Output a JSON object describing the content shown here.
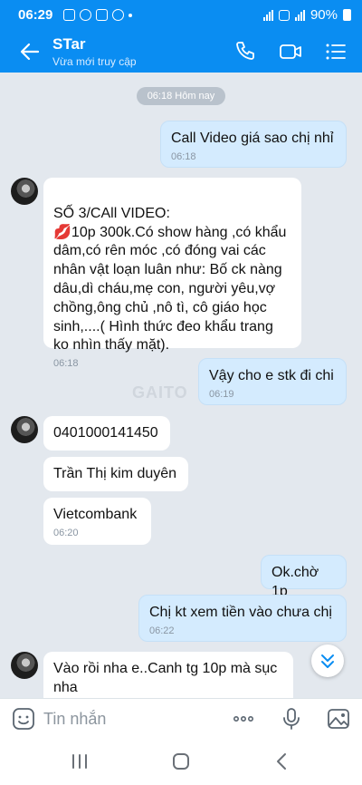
{
  "status_bar": {
    "time": "06:29",
    "battery": "90%"
  },
  "header": {
    "title": "STar",
    "subtitle": "Vừa mới truy cập"
  },
  "chat": {
    "day_label": "06:18 Hôm nay",
    "watermark": "GAITO",
    "messages": [
      {
        "id": "m1",
        "dir": "out",
        "text": "Call Video giá sao chị nhỉ",
        "time": "06:18"
      },
      {
        "id": "m2",
        "dir": "in",
        "text": "SỐ 3/CAll VIDEO:\n💋10p 300k.Có show hàng ,có khẩu dâm,có rên móc ,có đóng vai các nhân vật loạn luân như: Bố ck nàng dâu,dì cháu,mẹ con, người yêu,vợ chồng,ông chủ ,nô tì, cô giáo học sinh,....( Hình thức đeo khẩu trang ko nhìn thấy mặt).",
        "time": "06:18"
      },
      {
        "id": "m3",
        "dir": "out",
        "text": "Vậy cho e stk đi chi",
        "time": "06:19"
      },
      {
        "id": "m4",
        "dir": "in",
        "text": "0401000141450",
        "time": ""
      },
      {
        "id": "m5",
        "dir": "in",
        "text": "Trần Thị kim duyên",
        "time": ""
      },
      {
        "id": "m6",
        "dir": "in",
        "text": "Vietcombank",
        "time": "06:20"
      },
      {
        "id": "m7",
        "dir": "out",
        "text": "Ok.chờ 1p",
        "time": ""
      },
      {
        "id": "m8",
        "dir": "out",
        "text": "Chị kt xem tiền vào chưa chị",
        "time": "06:22"
      },
      {
        "id": "m9",
        "dir": "in",
        "text": "Vào rồi nha e..Canh tg 10p mà sục nha",
        "time": ""
      }
    ]
  },
  "input": {
    "placeholder": "Tin nhắn"
  }
}
